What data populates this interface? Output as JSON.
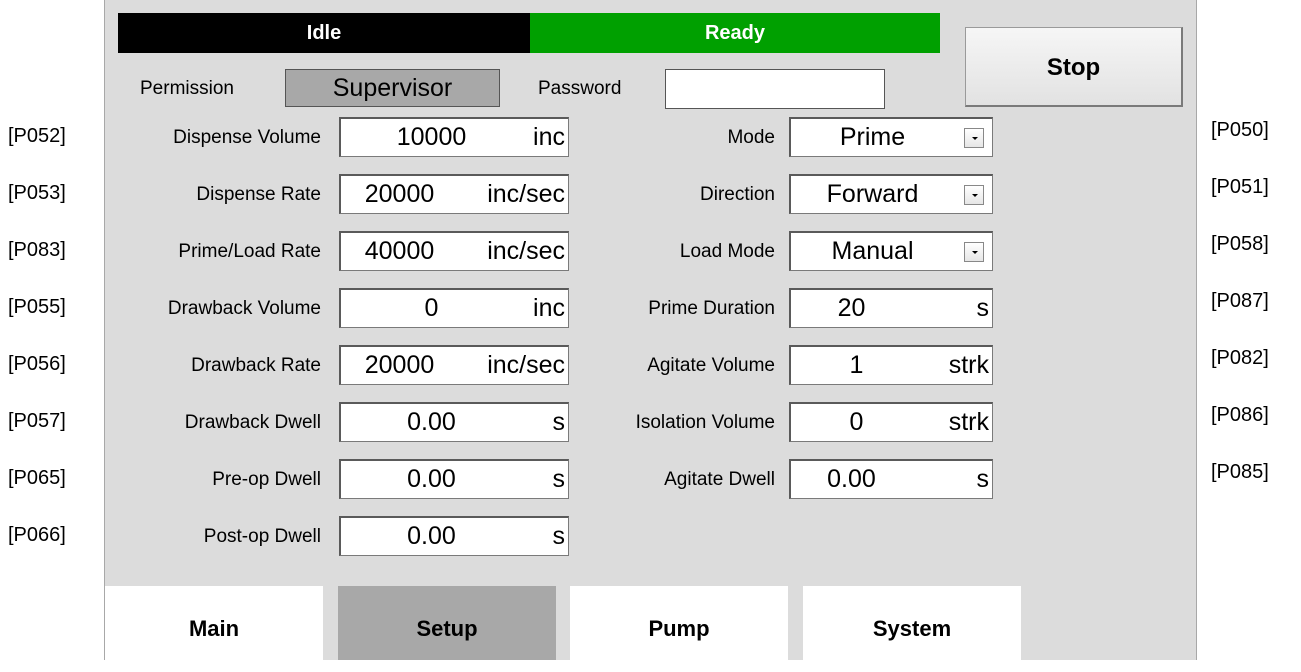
{
  "status": {
    "left": "Idle",
    "right": "Ready",
    "left_color": "#000000",
    "right_color": "#00a000"
  },
  "stop_button": "Stop",
  "permission": {
    "label": "Permission",
    "value": "Supervisor"
  },
  "password": {
    "label": "Password",
    "value": ""
  },
  "left_params": [
    {
      "code": "[P052]",
      "label": "Dispense Volume",
      "value": "10000",
      "unit": "inc"
    },
    {
      "code": "[P053]",
      "label": "Dispense Rate",
      "value": "20000",
      "unit": "inc/sec"
    },
    {
      "code": "[P083]",
      "label": "Prime/Load Rate",
      "value": "40000",
      "unit": "inc/sec"
    },
    {
      "code": "[P055]",
      "label": "Drawback Volume",
      "value": "0",
      "unit": "inc"
    },
    {
      "code": "[P056]",
      "label": "Drawback Rate",
      "value": "20000",
      "unit": "inc/sec"
    },
    {
      "code": "[P057]",
      "label": "Drawback Dwell",
      "value": "0.00",
      "unit": "s"
    },
    {
      "code": "[P065]",
      "label": "Pre-op Dwell",
      "value": "0.00",
      "unit": "s"
    },
    {
      "code": "[P066]",
      "label": "Post-op Dwell",
      "value": "0.00",
      "unit": "s"
    }
  ],
  "right_params": [
    {
      "code": "[P050]",
      "label": "Mode",
      "value": "Prime"
    },
    {
      "code": "[P051]",
      "label": "Direction",
      "value": "Forward"
    },
    {
      "code": "[P058]",
      "label": "Load Mode",
      "value": "Manual"
    },
    {
      "code": "[P087]",
      "label": "Prime Duration",
      "value": "20",
      "unit": "s"
    },
    {
      "code": "[P082]",
      "label": "Agitate Volume",
      "value": "1",
      "unit": "strk"
    },
    {
      "code": "[P086]",
      "label": "Isolation Volume",
      "value": "0",
      "unit": "strk"
    },
    {
      "code": "[P085]",
      "label": "Agitate Dwell",
      "value": "0.00",
      "unit": "s"
    }
  ],
  "tabs": [
    {
      "label": "Main",
      "active": false
    },
    {
      "label": "Setup",
      "active": true
    },
    {
      "label": "Pump",
      "active": false
    },
    {
      "label": "System",
      "active": false
    }
  ],
  "colors": {
    "panel_bg": "#dcdcdc",
    "active_tab": "#a8a8a8",
    "permission_bg": "#a8a8a8"
  },
  "icons": {
    "dropdown": "chevron-down-icon"
  }
}
